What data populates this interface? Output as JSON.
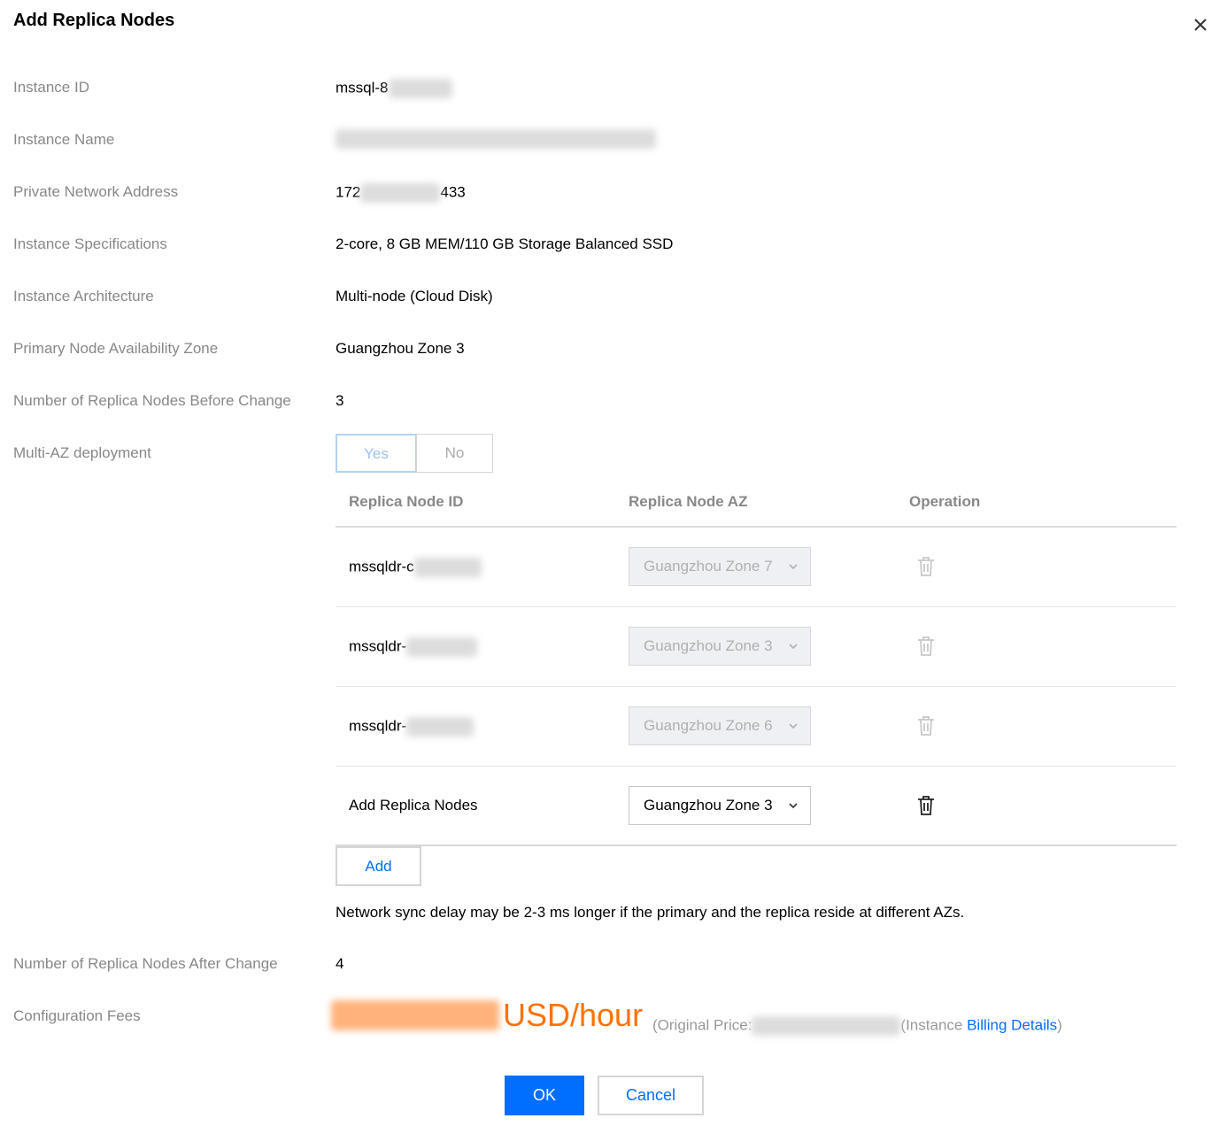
{
  "dialog": {
    "title": "Add Replica Nodes"
  },
  "fields": {
    "instance_id": {
      "label": "Instance ID",
      "value": "mssql-8"
    },
    "instance_name": {
      "label": "Instance Name"
    },
    "private_network": {
      "label": "Private Network Address",
      "value_prefix": "172",
      "value_suffix": "433"
    },
    "specifications": {
      "label": "Instance Specifications",
      "value": "2-core, 8 GB MEM/110 GB Storage Balanced SSD"
    },
    "architecture": {
      "label": "Instance Architecture",
      "value": "Multi-node (Cloud Disk)"
    },
    "primary_az": {
      "label": "Primary Node Availability Zone",
      "value": "Guangzhou Zone 3"
    },
    "replicas_before": {
      "label": "Number of Replica Nodes Before Change",
      "value": "3"
    },
    "multi_az": {
      "label": "Multi-AZ deployment",
      "yes": "Yes",
      "no": "No",
      "selected": "Yes"
    },
    "replicas_after": {
      "label": "Number of Replica Nodes After Change",
      "value": "4"
    },
    "fees": {
      "label": "Configuration Fees",
      "unit": "USD/hour",
      "orig_open": "(Original Price:",
      "instance_text": "(Instance ",
      "billing_link": "Billing Details",
      "close_paren": ")"
    }
  },
  "table": {
    "headers": {
      "id": "Replica Node ID",
      "az": "Replica Node AZ",
      "op": "Operation"
    },
    "rows": [
      {
        "id": "mssqldr-c",
        "az": "Guangzhou Zone 7",
        "disabled": true
      },
      {
        "id": "mssqldr-",
        "az": "Guangzhou Zone 3",
        "disabled": true
      },
      {
        "id": "mssqldr-",
        "az": "Guangzhou Zone 6",
        "disabled": true
      },
      {
        "id": "Add Replica Nodes",
        "az": "Guangzhou Zone 3",
        "disabled": false
      }
    ]
  },
  "add_button": "Add",
  "note": "Network sync delay may be 2-3 ms longer if the primary and the replica reside at different AZs.",
  "footer": {
    "ok": "OK",
    "cancel": "Cancel"
  },
  "colors": {
    "accent": "#006eff",
    "price": "#ff7200",
    "label": "#888888"
  },
  "icons": {
    "close": "close-icon",
    "trash": "trash-icon",
    "chevron": "chevron-down-icon"
  }
}
